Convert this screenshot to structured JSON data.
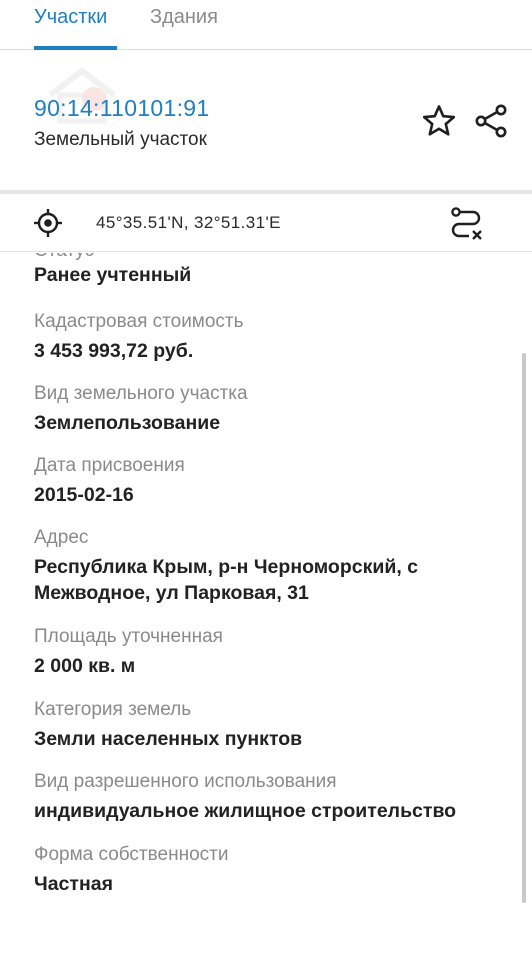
{
  "tabs": [
    {
      "label": "Участки",
      "active": true
    },
    {
      "label": "Здания",
      "active": false
    }
  ],
  "object": {
    "cadastral_number": "90:14:110101:91",
    "type": "Земельный участок"
  },
  "coordinates": "45°35.51'N, 32°51.31'E",
  "details": {
    "status_value": "Ранее учтенный",
    "fields": [
      {
        "label": "Кадастровая стоимость",
        "value": "3 453 993,72 руб."
      },
      {
        "label": "Вид земельного участка",
        "value": "Землепользование"
      },
      {
        "label": "Дата присвоения",
        "value": "2015-02-16"
      },
      {
        "label": "Адрес",
        "value": "Республика Крым, р-н Черноморский, с Межводное, ул Парковая, 31"
      },
      {
        "label": "Площадь уточненная",
        "value": "2 000 кв. м"
      },
      {
        "label": "Категория земель",
        "value": "Земли населенных пунктов"
      },
      {
        "label": "Вид разрешенного использования",
        "value": "индивидуальное жилищное строительство"
      },
      {
        "label": "Форма собственности",
        "value": "Частная"
      }
    ]
  },
  "colors": {
    "accent": "#1e7fc1",
    "label_gray": "#8a8a8a",
    "text_dark": "#222222"
  },
  "icons": [
    "star-icon",
    "share-icon",
    "locate-icon",
    "route-icon"
  ]
}
